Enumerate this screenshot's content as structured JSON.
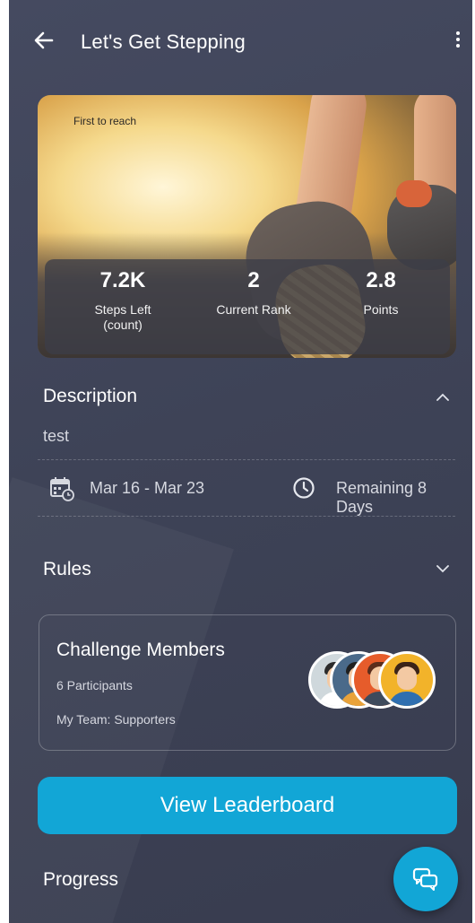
{
  "header": {
    "title": "Let's Get Stepping"
  },
  "hero": {
    "caption": "First to reach",
    "stats": [
      {
        "value": "7.2K",
        "label": "Steps Left\n(count)"
      },
      {
        "value": "2",
        "label": "Current Rank"
      },
      {
        "value": "2.8",
        "label": "Points"
      }
    ]
  },
  "description": {
    "title": "Description",
    "text": "test",
    "date_range": "Mar 16 - Mar 23",
    "remaining": "Remaining 8 Days",
    "expanded": true
  },
  "rules": {
    "title": "Rules",
    "expanded": false
  },
  "members": {
    "title": "Challenge Members",
    "participants": "6 Participants",
    "team": "My Team: Supporters"
  },
  "leaderboard_button": "View Leaderboard",
  "progress": {
    "title": "Progress"
  },
  "colors": {
    "accent": "#12a6d6",
    "background": "#3f4458"
  },
  "icons": {
    "back": "arrow-left-icon",
    "more": "more-vertical-icon",
    "collapse": "chevron-up-icon",
    "expand": "chevron-down-icon",
    "calendar": "calendar-clock-icon",
    "clock": "clock-icon",
    "chat": "chat-bubbles-icon"
  }
}
